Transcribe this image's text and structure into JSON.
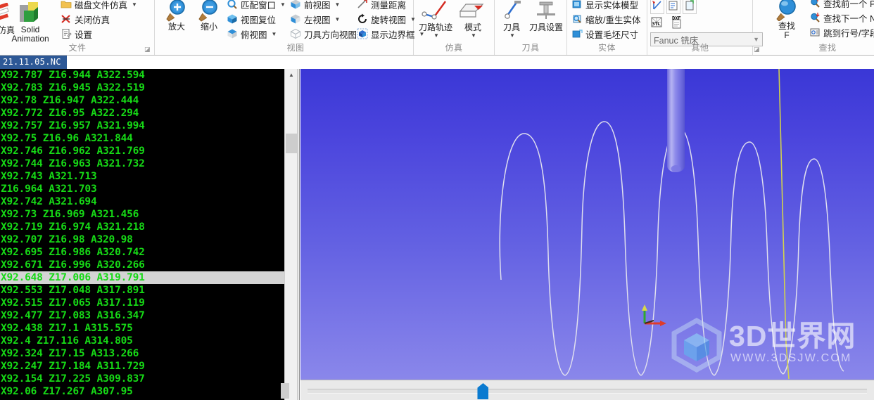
{
  "ribbon": {
    "groups": [
      {
        "name": "file",
        "label": "文件"
      },
      {
        "name": "view",
        "label": "视图"
      },
      {
        "name": "simulation",
        "label": "仿真"
      },
      {
        "name": "tool",
        "label": "刀具"
      },
      {
        "name": "solid",
        "label": "实体"
      },
      {
        "name": "other",
        "label": "其他"
      },
      {
        "name": "find",
        "label": "查找"
      }
    ],
    "file": {
      "partial_sim_label": "件仿真",
      "solid_animation_line1": "Solid",
      "solid_animation_line2": "Animation",
      "disk_file_sim": "磁盘文件仿真",
      "close_sim": "关闭仿真",
      "settings": "设置"
    },
    "view": {
      "zoom_in": "放大",
      "zoom_out": "缩小",
      "fit_window": "匹配窗口",
      "view_reset": "视图复位",
      "top_view": "俯视图",
      "front_view": "前视图",
      "left_view": "左视图",
      "tool_dir_view": "刀具方向视图",
      "measure_distance": "测量距离",
      "rotate_view": "旋转视图",
      "show_bounding_box": "显示边界框"
    },
    "simulation": {
      "toolpath": "刀路轨迹",
      "mode": "模式"
    },
    "tool": {
      "tool": "刀具",
      "tool_settings": "刀具设置"
    },
    "solid": {
      "show_solid_model": "显示实体模型",
      "zoom_regen_solid": "缩放/重生实体",
      "set_stock_size": "设置毛坯尺寸"
    },
    "other": {
      "machine_select_value": "Fanuc 铣床"
    },
    "find": {
      "find_label_line1": "查找",
      "find_label_line2": "F",
      "find_prev": "查找前一个 P",
      "find_next": "查找下一个 N",
      "goto_line": "跳到行号/字段"
    }
  },
  "editor": {
    "tab_title": "21.11.05.NC",
    "selected_line_index": 16,
    "lines": [
      "X92.787 Z16.944 A322.594",
      "X92.783 Z16.945 A322.519",
      "X92.78 Z16.947 A322.444",
      "X92.772 Z16.95 A322.294",
      "X92.757 Z16.957 A321.994",
      "X92.75 Z16.96 A321.844",
      "X92.746 Z16.962 A321.769",
      "X92.744 Z16.963 A321.732",
      "X92.743 A321.713",
      "Z16.964 A321.703",
      "X92.742 A321.694",
      "X92.73 Z16.969 A321.456",
      "X92.719 Z16.974 A321.218",
      "X92.707 Z16.98 A320.98",
      "X92.695 Z16.986 A320.742",
      "X92.671 Z16.996 A320.266",
      "X92.648 Z17.006 A319.791",
      "X92.553 Z17.048 A317.891",
      "X92.515 Z17.065 A317.119",
      "X92.477 Z17.083 A316.347",
      "X92.438 Z17.1 A315.575",
      "X92.4 Z17.116 A314.805",
      "X92.324 Z17.15 A313.266",
      "X92.247 Z17.184 A311.729",
      "X92.154 Z17.225 A309.837",
      "X92.06 Z17.267 A307.95"
    ]
  },
  "viewport": {
    "axis_x_label": "X",
    "axis_y_label": "Y",
    "colors": {
      "background_top": "#3a37d6",
      "background_bottom": "#8a87ea",
      "toolpath": "#e8e8f0",
      "tool_body": "#8f8ce8",
      "rapid_line": "#d9d94a",
      "axis_x": "#e03b2a",
      "axis_y": "#2fa82f"
    },
    "slider_value_percent": 31
  },
  "watermark": {
    "title": "3D世界网",
    "url": "WWW.3DSJW.COM"
  }
}
